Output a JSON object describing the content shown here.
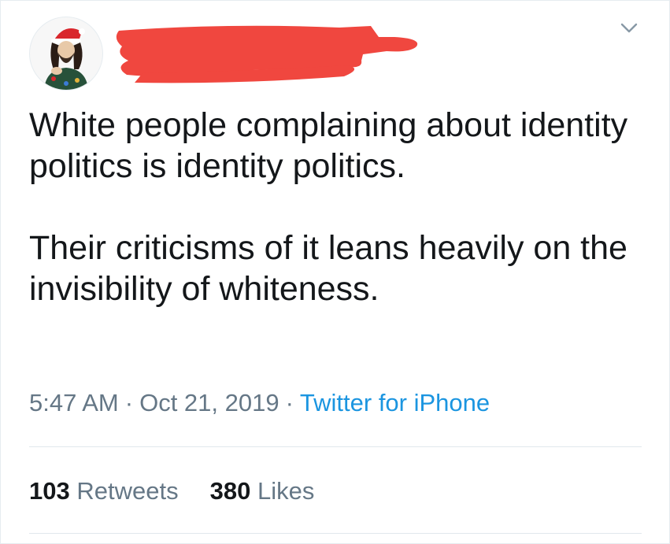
{
  "tweet": {
    "text_paragraphs": [
      "White people complaining about identity politics is identity politics.",
      "Their criticisms of it leans heavily on the invisibility of whiteness."
    ],
    "time": "5:47 AM",
    "date": "Oct 21, 2019",
    "separator": "·",
    "source": "Twitter for iPhone",
    "retweets_count": "103",
    "retweets_label": "Retweets",
    "likes_count": "380",
    "likes_label": "Likes"
  },
  "colors": {
    "text": "#14171a",
    "secondary": "#657786",
    "link": "#1b95e0",
    "redaction": "#f0473f",
    "divider": "#e1e8ed"
  },
  "icons": {
    "menu": "chevron-down-icon",
    "avatar": "avatar-santa-hat-illustration"
  }
}
